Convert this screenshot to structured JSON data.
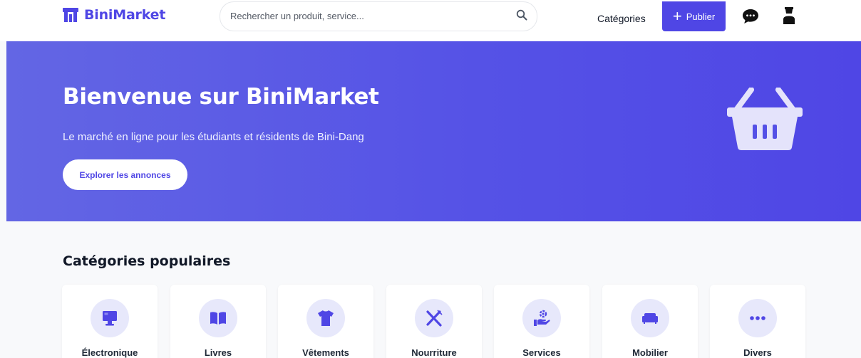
{
  "header": {
    "brand": "BiniMarket",
    "search": {
      "placeholder": "Rechercher un produit, service..."
    },
    "nav_categories": "Catégories",
    "publish_label": "Publier"
  },
  "hero": {
    "title": "Bienvenue sur BiniMarket",
    "subtitle": "Le marché en ligne pour les étudiants et résidents de Bini-Dang",
    "cta": "Explorer les annonces"
  },
  "categories": {
    "title": "Catégories populaires",
    "items": [
      {
        "label": "Électronique",
        "icon": "monitor-icon"
      },
      {
        "label": "Livres",
        "icon": "book-icon"
      },
      {
        "label": "Vêtements",
        "icon": "tshirt-icon"
      },
      {
        "label": "Nourriture",
        "icon": "utensils-icon"
      },
      {
        "label": "Services",
        "icon": "hand-service-icon"
      },
      {
        "label": "Mobilier",
        "icon": "couch-icon"
      },
      {
        "label": "Divers",
        "icon": "ellipsis-icon"
      }
    ]
  },
  "colors": {
    "brand": "#4f46e5",
    "hero_start": "#6366e4",
    "icon_bg": "#e7e8fb"
  }
}
